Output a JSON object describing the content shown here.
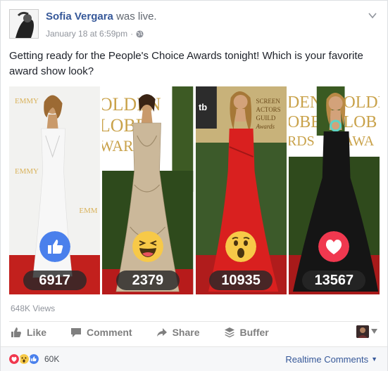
{
  "post": {
    "author_name": "Sofia Vergara",
    "author_action": "was live.",
    "date": "January 18 at 6:59pm",
    "separator": "·",
    "text": "Getting ready for the People's Choice Awards tonight! Which is your favorite award show look?",
    "views": "648K Views"
  },
  "photos": [
    {
      "reaction": "like-icon",
      "count": "6917",
      "reaction_color": "#4a80ec",
      "dress_color": "#f5f5f5",
      "backdrop_color": "#f2f2f0",
      "backdrop_text": "EMMY"
    },
    {
      "reaction": "haha-icon",
      "count": "2379",
      "reaction_color": "#f7c948",
      "dress_color": "#c9b79c",
      "backdrop_color": "#ffffff",
      "backdrop_text": "GOLDEN GLOBE AWARDS"
    },
    {
      "reaction": "wow-icon",
      "count": "10935",
      "reaction_color": "#f7c948",
      "dress_color": "#d9201f",
      "backdrop_color": "#c8b27a",
      "backdrop_text": "SCREEN ACTORS GUILD Awards"
    },
    {
      "reaction": "love-icon",
      "count": "13567",
      "reaction_color": "#f0384f",
      "dress_color": "#151515",
      "backdrop_color": "#ffffff",
      "backdrop_text": "GOLDEN GLOBE AWARDS"
    }
  ],
  "actions": {
    "like": "Like",
    "comment": "Comment",
    "share": "Share",
    "buffer": "Buffer"
  },
  "footer": {
    "reaction_total": "60K",
    "realtime_comments": "Realtime Comments"
  },
  "colors": {
    "link": "#365899",
    "muted": "#90949c",
    "like_blue": "#4a80ec",
    "love_red": "#f0384f",
    "reaction_yellow": "#f7c948"
  }
}
